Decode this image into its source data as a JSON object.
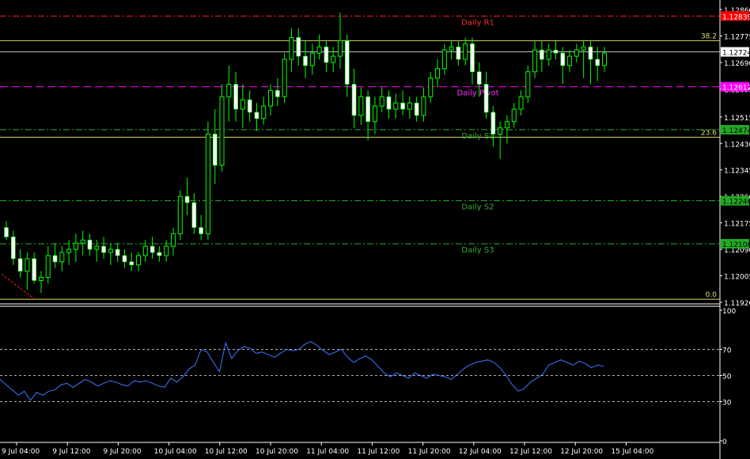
{
  "chart_data": [
    {
      "type": "candlestick",
      "x_ticks": [
        "9 Jul 04:00",
        "9 Jul 12:00",
        "9 Jul 20:00",
        "10 Jul 04:00",
        "10 Jul 12:00",
        "10 Jul 20:00",
        "11 Jul 04:00",
        "11 Jul 12:00",
        "11 Jul 20:00",
        "12 Jul 04:00",
        "12 Jul 12:00",
        "12 Jul 20:00",
        "15 Jul 04:00"
      ],
      "ylim": [
        1.1192,
        1.1286
      ],
      "y_ticks": [
        "1.12860",
        "1.12775",
        "1.12690",
        "1.12605",
        "1.12515",
        "1.12430",
        "1.12345",
        "1.12260",
        "1.12175",
        "1.12090",
        "1.12005",
        "1.11920"
      ],
      "current_price": "1.12724",
      "levels": [
        {
          "label": "Daily R1",
          "price": 1.12839,
          "tag": "1.12839",
          "color": "#ff2020",
          "tag_bg": "#ff0000",
          "tag_fg": "#ffffff",
          "style": "dashdot",
          "label_color": "#ff2a2a"
        },
        {
          "label": "Daily Pivot",
          "price": 1.12612,
          "tag": "1.12612",
          "color": "#ff00ff",
          "tag_bg": "#ff00ff",
          "tag_fg": "#ffffff",
          "style": "dash",
          "label_color": "#ff30ff"
        },
        {
          "label": "Daily S1",
          "price": 1.12474,
          "tag": "1.12474",
          "color": "#27b027",
          "tag_bg": "#22aa22",
          "tag_fg": "#000000",
          "style": "dashdot",
          "label_color": "#33aa33"
        },
        {
          "label": "Daily S2",
          "price": 1.12246,
          "tag": "1.12246",
          "color": "#27b027",
          "tag_bg": "#22aa22",
          "tag_fg": "#000000",
          "style": "dashdot",
          "label_color": "#33aa33"
        },
        {
          "label": "Daily S3",
          "price": 1.12108,
          "tag": "1.12108",
          "color": "#27b027",
          "tag_bg": "#22aa22",
          "tag_fg": "#000000",
          "style": "dashdot",
          "label_color": "#33aa33"
        }
      ],
      "fibo": [
        {
          "label": "38.2",
          "price": 1.1276
        },
        {
          "label": "23.6",
          "price": 1.1245
        },
        {
          "label": "0.0",
          "price": 1.1193
        }
      ],
      "candles": [
        [
          1.1216,
          1.1218,
          1.1212,
          1.1213
        ],
        [
          1.1213,
          1.1215,
          1.1204,
          1.1206
        ],
        [
          1.1206,
          1.1209,
          1.12,
          1.1202
        ],
        [
          1.1202,
          1.1208,
          1.1196,
          1.1206
        ],
        [
          1.1206,
          1.1208,
          1.1198,
          1.1199
        ],
        [
          1.1199,
          1.1202,
          1.1195,
          1.12
        ],
        [
          1.12,
          1.121,
          1.1198,
          1.1207
        ],
        [
          1.1207,
          1.1211,
          1.1203,
          1.1205
        ],
        [
          1.1205,
          1.121,
          1.1202,
          1.1208
        ],
        [
          1.1208,
          1.1212,
          1.1204,
          1.1209
        ],
        [
          1.1209,
          1.1214,
          1.1205,
          1.1211
        ],
        [
          1.1211,
          1.1215,
          1.1207,
          1.1212
        ],
        [
          1.1212,
          1.1214,
          1.1207,
          1.1209
        ],
        [
          1.1209,
          1.1212,
          1.1205,
          1.121
        ],
        [
          1.121,
          1.1213,
          1.1206,
          1.1208
        ],
        [
          1.1208,
          1.1211,
          1.1204,
          1.1209
        ],
        [
          1.1209,
          1.1211,
          1.1205,
          1.1207
        ],
        [
          1.1207,
          1.1209,
          1.1203,
          1.1205
        ],
        [
          1.1205,
          1.1208,
          1.1202,
          1.1204
        ],
        [
          1.1204,
          1.1208,
          1.1202,
          1.1207
        ],
        [
          1.1207,
          1.1212,
          1.1205,
          1.121
        ],
        [
          1.121,
          1.1213,
          1.1206,
          1.1208
        ],
        [
          1.1208,
          1.121,
          1.1205,
          1.1207
        ],
        [
          1.1207,
          1.1212,
          1.1205,
          1.121
        ],
        [
          1.121,
          1.1216,
          1.1207,
          1.1214
        ],
        [
          1.1214,
          1.1228,
          1.1212,
          1.1226
        ],
        [
          1.1226,
          1.1232,
          1.122,
          1.1224
        ],
        [
          1.1224,
          1.1227,
          1.1214,
          1.1216
        ],
        [
          1.1216,
          1.122,
          1.1212,
          1.1214
        ],
        [
          1.1214,
          1.125,
          1.1212,
          1.1246
        ],
        [
          1.1246,
          1.1254,
          1.123,
          1.1236
        ],
        [
          1.1236,
          1.1262,
          1.1234,
          1.1258
        ],
        [
          1.1258,
          1.1268,
          1.125,
          1.1262
        ],
        [
          1.1262,
          1.1266,
          1.125,
          1.1254
        ],
        [
          1.1254,
          1.1262,
          1.1248,
          1.1257
        ],
        [
          1.1257,
          1.126,
          1.125,
          1.1253
        ],
        [
          1.1253,
          1.1256,
          1.1247,
          1.1251
        ],
        [
          1.1251,
          1.1258,
          1.1249,
          1.1255
        ],
        [
          1.1255,
          1.1262,
          1.1252,
          1.126
        ],
        [
          1.126,
          1.1264,
          1.1255,
          1.1258
        ],
        [
          1.1258,
          1.1272,
          1.1256,
          1.127
        ],
        [
          1.127,
          1.128,
          1.1266,
          1.1277
        ],
        [
          1.1277,
          1.128,
          1.1268,
          1.1271
        ],
        [
          1.1271,
          1.1276,
          1.1264,
          1.1268
        ],
        [
          1.1268,
          1.1275,
          1.1265,
          1.1272
        ],
        [
          1.1272,
          1.1278,
          1.127,
          1.1274
        ],
        [
          1.1274,
          1.1276,
          1.1266,
          1.1269
        ],
        [
          1.1269,
          1.1274,
          1.1266,
          1.1271
        ],
        [
          1.1271,
          1.1285,
          1.1267,
          1.1276
        ],
        [
          1.1276,
          1.1278,
          1.1258,
          1.1262
        ],
        [
          1.1262,
          1.1267,
          1.1248,
          1.1252
        ],
        [
          1.1252,
          1.1261,
          1.1249,
          1.1258
        ],
        [
          1.1258,
          1.126,
          1.1244,
          1.125
        ],
        [
          1.125,
          1.1258,
          1.1246,
          1.1255
        ],
        [
          1.1255,
          1.1261,
          1.1253,
          1.1258
        ],
        [
          1.1258,
          1.126,
          1.1251,
          1.1254
        ],
        [
          1.1254,
          1.1259,
          1.1251,
          1.1256
        ],
        [
          1.1256,
          1.126,
          1.1252,
          1.1254
        ],
        [
          1.1254,
          1.1258,
          1.1251,
          1.1256
        ],
        [
          1.1256,
          1.1258,
          1.125,
          1.1252
        ],
        [
          1.1252,
          1.1261,
          1.125,
          1.1258
        ],
        [
          1.1258,
          1.1266,
          1.1256,
          1.1264
        ],
        [
          1.1264,
          1.127,
          1.1261,
          1.1267
        ],
        [
          1.1267,
          1.1275,
          1.1265,
          1.1273
        ],
        [
          1.1273,
          1.1276,
          1.127,
          1.1274
        ],
        [
          1.1274,
          1.1276,
          1.1268,
          1.127
        ],
        [
          1.127,
          1.1277,
          1.1268,
          1.1275
        ],
        [
          1.1275,
          1.1277,
          1.1262,
          1.1266
        ],
        [
          1.1266,
          1.1269,
          1.1258,
          1.1262
        ],
        [
          1.1262,
          1.1266,
          1.1251,
          1.1253
        ],
        [
          1.1253,
          1.1255,
          1.1242,
          1.1246
        ],
        [
          1.1246,
          1.125,
          1.1238,
          1.1248
        ],
        [
          1.1248,
          1.1252,
          1.1243,
          1.125
        ],
        [
          1.125,
          1.1256,
          1.1248,
          1.1254
        ],
        [
          1.1254,
          1.126,
          1.1252,
          1.1258
        ],
        [
          1.1258,
          1.1268,
          1.1256,
          1.1266
        ],
        [
          1.1266,
          1.1276,
          1.1264,
          1.1273
        ],
        [
          1.1273,
          1.1276,
          1.1266,
          1.127
        ],
        [
          1.127,
          1.1275,
          1.1268,
          1.1273
        ],
        [
          1.1273,
          1.1276,
          1.127,
          1.1272
        ],
        [
          1.1272,
          1.1274,
          1.1262,
          1.1268
        ],
        [
          1.1268,
          1.1273,
          1.1266,
          1.1271
        ],
        [
          1.1271,
          1.1275,
          1.1269,
          1.1273
        ],
        [
          1.1273,
          1.1276,
          1.1264,
          1.1274
        ],
        [
          1.1274,
          1.1276,
          1.1262,
          1.127
        ],
        [
          1.127,
          1.1274,
          1.1263,
          1.1268
        ],
        [
          1.1268,
          1.1274,
          1.1266,
          1.1272
        ]
      ],
      "indicator": {
        "levels": [
          30,
          50,
          70
        ],
        "scale_ticks": [
          "100",
          "70",
          "50",
          "30",
          "0"
        ],
        "values": [
          47,
          43,
          39,
          35,
          38,
          31,
          37,
          35,
          38,
          39,
          43,
          44,
          41,
          44,
          47,
          45,
          42,
          44,
          46,
          45,
          43,
          42,
          46,
          45,
          46,
          44,
          42,
          41,
          48,
          45,
          49,
          55,
          58,
          70,
          68,
          60,
          53,
          75,
          63,
          69,
          72,
          71,
          67,
          68,
          66,
          64,
          67,
          70,
          69,
          70,
          74,
          76,
          73,
          69,
          66,
          68,
          70,
          64,
          60,
          63,
          65,
          62,
          57,
          52,
          49,
          52,
          50,
          48,
          52,
          50,
          48,
          51,
          50,
          49,
          47,
          51,
          55,
          58,
          60,
          61,
          62,
          60,
          56,
          50,
          43,
          38,
          40,
          45,
          48,
          51,
          58,
          60,
          62,
          60,
          58,
          61,
          59,
          56,
          58,
          57
        ]
      }
    }
  ]
}
